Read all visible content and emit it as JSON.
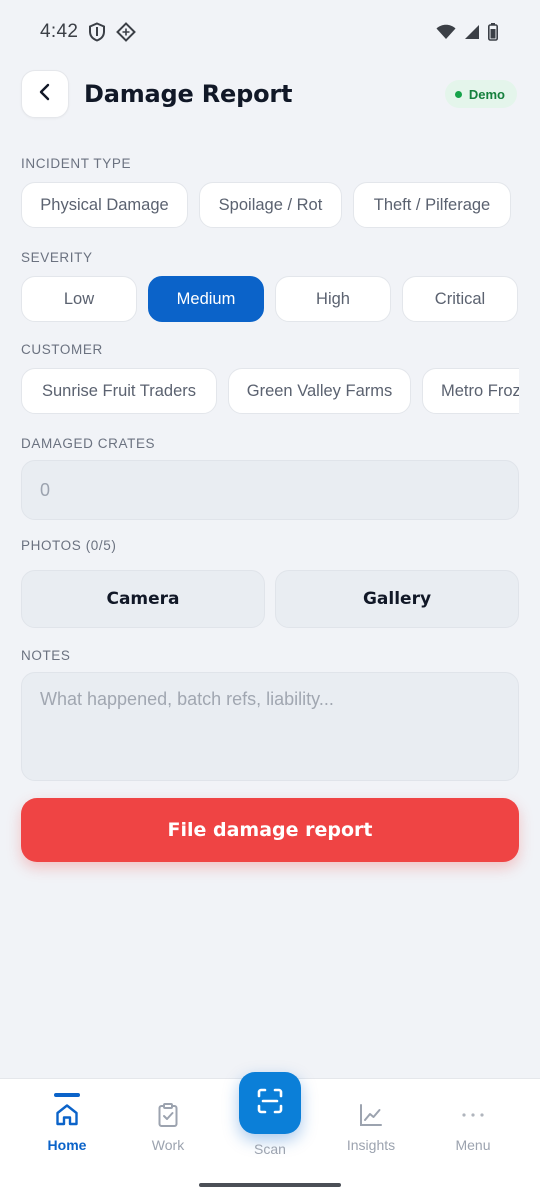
{
  "status_bar": {
    "time": "4:42",
    "left_icons": [
      "shield-icon",
      "diamond-grid-icon"
    ],
    "right_icons": [
      "wifi-icon",
      "signal-icon",
      "battery-icon"
    ]
  },
  "header": {
    "title": "Damage Report",
    "back_icon": "chevron-left-icon",
    "badge": "Demo",
    "badge_color": "#15803d"
  },
  "incident_type": {
    "label": "INCIDENT TYPE",
    "options": [
      "Physical Damage",
      "Spoilage / Rot",
      "Theft / Pilferage"
    ]
  },
  "severity": {
    "label": "SEVERITY",
    "options": [
      "Low",
      "Medium",
      "High",
      "Critical"
    ],
    "selected": "Medium",
    "accent": "#0b63c9"
  },
  "customer": {
    "label": "CUSTOMER",
    "options": [
      "Sunrise Fruit Traders",
      "Green Valley Farms",
      "Metro Froz"
    ]
  },
  "damaged_crates": {
    "label": "DAMAGED CRATES",
    "placeholder": "0"
  },
  "photos": {
    "label": "PHOTOS (0/5)",
    "camera": "Camera",
    "gallery": "Gallery"
  },
  "notes": {
    "label": "NOTES",
    "placeholder": "What happened, batch refs, liability..."
  },
  "submit": {
    "label": "File damage report",
    "color": "#ef4444"
  },
  "bottom_nav": {
    "items": [
      {
        "label": "Home",
        "icon": "home-icon",
        "active": true
      },
      {
        "label": "Work",
        "icon": "clipboard-check-icon",
        "active": false
      },
      {
        "label": "Scan",
        "icon": "scan-icon",
        "active": false
      },
      {
        "label": "Insights",
        "icon": "chart-line-icon",
        "active": false
      },
      {
        "label": "Menu",
        "icon": "more-horizontal-icon",
        "active": false
      }
    ]
  }
}
